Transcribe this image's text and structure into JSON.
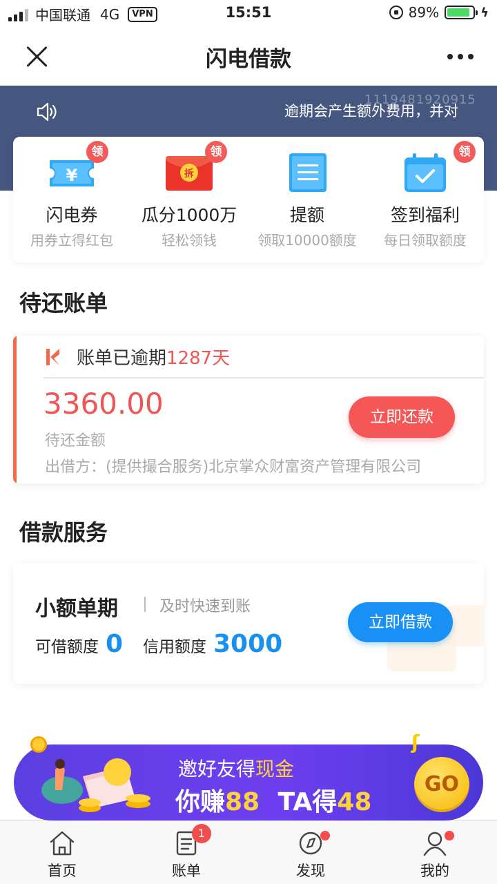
{
  "status_bar": {
    "carrier": "中国联通",
    "network": "4G",
    "vpn": "VPN",
    "time": "15:51",
    "battery": "89%",
    "battery_level": 0.89
  },
  "nav": {
    "title": "闪电借款"
  },
  "notice": {
    "text": "逾期会产生额外费用，并对",
    "watermark": "1119481920915"
  },
  "quick_actions": [
    {
      "title": "闪电券",
      "subtitle": "用券立得红包",
      "badge": "领",
      "icon": "ticket-icon"
    },
    {
      "title": "瓜分1000万",
      "subtitle": "轻松领钱",
      "badge": "领",
      "icon": "red-envelope-icon",
      "icon_text": "拆"
    },
    {
      "title": "提额",
      "subtitle": "领取10000额度",
      "icon": "document-icon"
    },
    {
      "title": "签到福利",
      "subtitle": "每日领取额度",
      "badge": "领",
      "icon": "calendar-check-icon"
    }
  ],
  "bill_section": {
    "title": "待还账单",
    "status_prefix": "账单已逾期",
    "overdue_days": "1287天",
    "amount": "3360.00",
    "amount_label": "待还金额",
    "lender": "出借方：(提供撮合服务)北京掌众财富资产管理有限公司",
    "repay_button": "立即还款"
  },
  "loan_section": {
    "title": "借款服务",
    "product": "小额单期",
    "tagline": "及时快速到账",
    "available_label": "可借额度",
    "available_value": "0",
    "credit_label": "信用额度",
    "credit_value": "3000",
    "borrow_button": "立即借款"
  },
  "promo": {
    "line1_prefix": "邀好友得",
    "line1_highlight": "现金",
    "line2_you": "你赚",
    "line2_you_amount": "88",
    "line2_ta": "TA得",
    "line2_ta_amount": "48",
    "go": "GO"
  },
  "tabs": [
    {
      "label": "首页",
      "icon": "home-icon"
    },
    {
      "label": "账单",
      "icon": "bill-icon",
      "badge": "1"
    },
    {
      "label": "发现",
      "icon": "compass-icon"
    },
    {
      "label": "我的",
      "icon": "user-icon"
    }
  ],
  "colors": {
    "band": "#46577f",
    "accent_red": "#f25454",
    "accent_blue": "#1890f5",
    "promo_purple": "#6e3ff0"
  }
}
